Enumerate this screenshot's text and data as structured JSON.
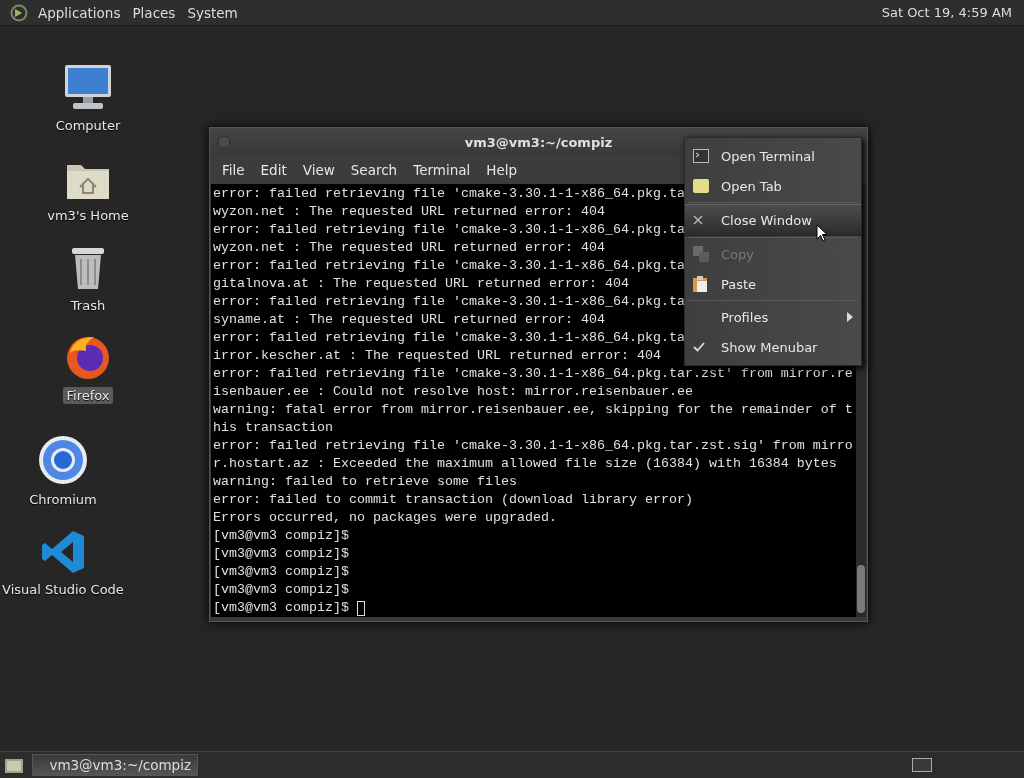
{
  "top_panel": {
    "menus": [
      "Applications",
      "Places",
      "System"
    ],
    "clock": "Sat Oct 19,  4:59 AM"
  },
  "desktop_icons": [
    {
      "kind": "computer",
      "label": "Computer",
      "selected": false
    },
    {
      "kind": "home",
      "label": "vm3's Home",
      "selected": false
    },
    {
      "kind": "trash",
      "label": "Trash",
      "selected": false
    },
    {
      "kind": "fox",
      "label": "Firefox",
      "selected": true
    },
    {
      "kind": "ring",
      "label": "Chromium",
      "selected": false
    },
    {
      "kind": "ribbon",
      "label": "Visual Studio Code",
      "selected": false
    }
  ],
  "window": {
    "title": "vm3@vm3:~/compiz",
    "menus": [
      "File",
      "Edit",
      "View",
      "Search",
      "Terminal",
      "Help"
    ],
    "lines": [
      "error: failed retrieving file 'cmake-3.30.1-1-x86_64.pkg.ta",
      "wyzon.net : The requested URL returned error: 404",
      "error: failed retrieving file 'cmake-3.30.1-1-x86_64.pkg.ta",
      "wyzon.net : The requested URL returned error: 404",
      "error: failed retrieving file 'cmake-3.30.1-1-x86_64.pkg.ta",
      "gitalnova.at : The requested URL returned error: 404",
      "error: failed retrieving file 'cmake-3.30.1-1-x86_64.pkg.ta",
      "syname.at : The requested URL returned error: 404",
      "error: failed retrieving file 'cmake-3.30.1-1-x86_64.pkg.ta",
      "irror.kescher.at : The requested URL returned error: 404",
      "error: failed retrieving file 'cmake-3.30.1-1-x86_64.pkg.tar.zst' from mirror.re",
      "isenbauer.ee : Could not resolve host: mirror.reisenbauer.ee",
      "warning: fatal error from mirror.reisenbauer.ee, skipping for the remainder of t",
      "his transaction",
      "error: failed retrieving file 'cmake-3.30.1-1-x86_64.pkg.tar.zst.sig' from mirro",
      "r.hostart.az : Exceeded the maximum allowed file size (16384) with 16384 bytes",
      "warning: failed to retrieve some files",
      "error: failed to commit transaction (download library error)",
      "Errors occurred, no packages were upgraded.",
      "[vm3@vm3 compiz]$",
      "[vm3@vm3 compiz]$",
      "[vm3@vm3 compiz]$",
      "[vm3@vm3 compiz]$",
      "[vm3@vm3 compiz]$ "
    ],
    "cursor": true
  },
  "context_menu": [
    {
      "kind": "terminal",
      "label": "Open Terminal",
      "selected": false,
      "disabled": false
    },
    {
      "kind": "tab",
      "label": "Open Tab",
      "selected": false,
      "disabled": false
    },
    {
      "kind": "separator"
    },
    {
      "kind": "close",
      "label": "Close Window",
      "selected": true,
      "disabled": false
    },
    {
      "kind": "separator"
    },
    {
      "kind": "copy",
      "label": "Copy",
      "selected": false,
      "disabled": true
    },
    {
      "kind": "paste",
      "label": "Paste",
      "selected": false,
      "disabled": false
    },
    {
      "kind": "separator"
    },
    {
      "kind": "submenu",
      "label": "Profiles",
      "selected": false,
      "disabled": false
    },
    {
      "kind": "check",
      "label": "Show Menubar",
      "checked": true,
      "selected": false,
      "disabled": false
    }
  ],
  "taskbar": {
    "tasks": [
      {
        "label": "vm3@vm3:~/compiz",
        "selected": true
      }
    ]
  }
}
